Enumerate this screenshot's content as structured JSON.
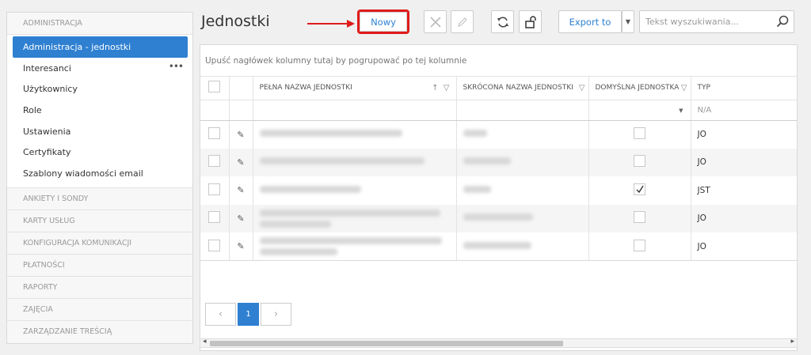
{
  "sidebar": {
    "sections": [
      "ADMINISTRACJA",
      "ANKIETY I SONDY",
      "KARTY USŁUG",
      "KONFIGURACJA KOMUNIKACJI",
      "PŁATNOŚCI",
      "RAPORTY",
      "ZAJĘCIA",
      "ZARZĄDZANIE TREŚCIĄ"
    ],
    "items": [
      {
        "label": "Administracja - jednostki",
        "active": true
      },
      {
        "label": "Interesanci",
        "more": "•••"
      },
      {
        "label": "Użytkownicy"
      },
      {
        "label": "Role"
      },
      {
        "label": "Ustawienia"
      },
      {
        "label": "Certyfikaty"
      },
      {
        "label": "Szablony wiadomości email"
      }
    ]
  },
  "header": {
    "title": "Jednostki",
    "new_label": "Nowy",
    "export_label": "Export to",
    "search_placeholder": "Tekst wyszukiwania..."
  },
  "grid": {
    "group_hint": "Upuść nagłówek kolumny tutaj by pogrupować po tej kolumnie",
    "columns": [
      "PEŁNA NAZWA JEDNOSTKI",
      "SKRÓCONA NAZWA JEDNOSTKI",
      "DOMYŚLNA JEDNOSTKA",
      "TYP"
    ],
    "filter": {
      "typ": "N/A"
    },
    "rows": [
      {
        "typ": "JO",
        "default": false
      },
      {
        "typ": "JO",
        "default": false
      },
      {
        "typ": "JST",
        "default": true
      },
      {
        "typ": "JO",
        "default": false
      },
      {
        "typ": "JO",
        "default": false
      }
    ],
    "pager": {
      "current": "1",
      "prev": "‹",
      "next": "›"
    }
  },
  "colors": {
    "accent": "#2f80d1",
    "highlight": "#e01b1b"
  }
}
